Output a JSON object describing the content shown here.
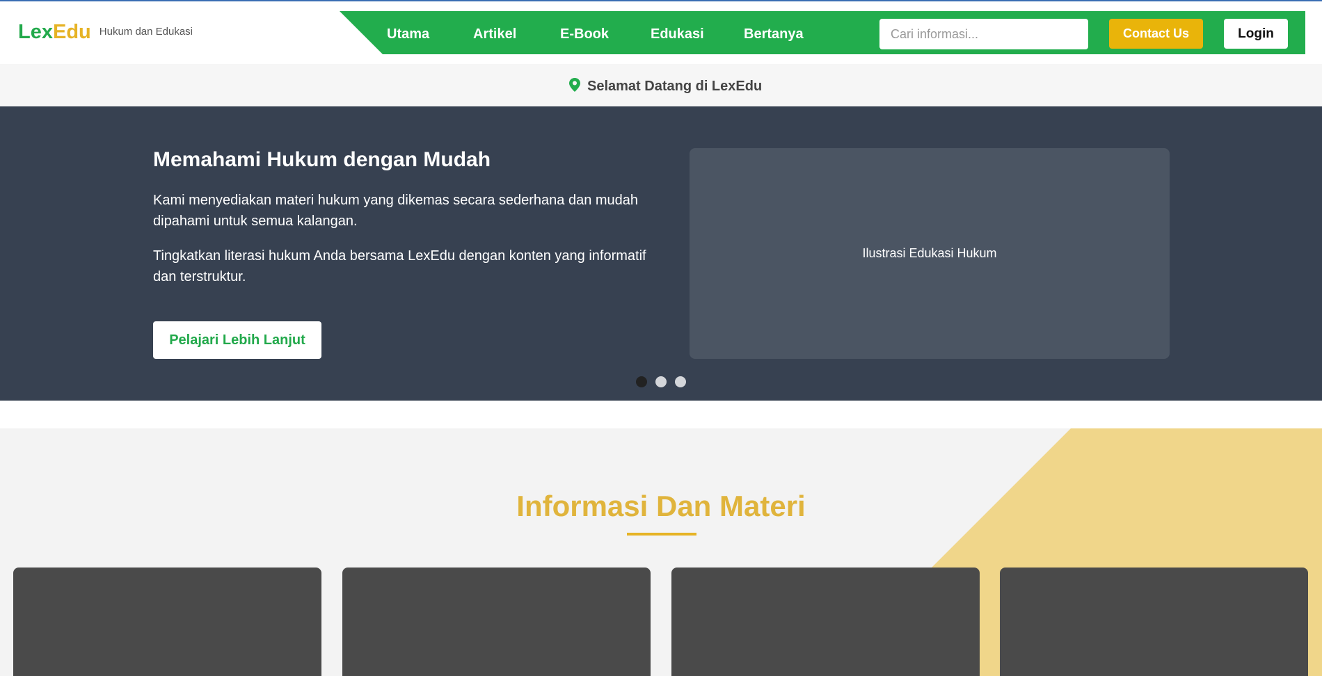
{
  "brand": {
    "name_part1": "Lex",
    "name_part2": "Edu",
    "tagline": "Hukum dan Edukasi"
  },
  "nav": {
    "items": [
      {
        "label": "Utama"
      },
      {
        "label": "Artikel"
      },
      {
        "label": "E-Book"
      },
      {
        "label": "Edukasi"
      },
      {
        "label": "Bertanya"
      }
    ]
  },
  "search": {
    "placeholder": "Cari informasi...",
    "value": ""
  },
  "buttons": {
    "contact": "Contact Us",
    "login": "Login"
  },
  "welcome": {
    "icon": "map-pin-icon",
    "text": "Selamat Datang di LexEdu"
  },
  "hero": {
    "title": "Memahami Hukum dengan Mudah",
    "paragraph1": "Kami menyediakan materi hukum yang dikemas secara sederhana dan mudah dipahami untuk semua kalangan.",
    "paragraph2": "Tingkatkan literasi hukum Anda bersama LexEdu dengan konten yang informatif dan terstruktur.",
    "cta": "Pelajari Lebih Lanjut",
    "illustration_text": "Ilustrasi Edukasi Hukum",
    "slides_count": 3,
    "active_slide": 1
  },
  "info": {
    "title": "Informasi Dan Materi",
    "cards_count": 4
  },
  "colors": {
    "green": "#22ad4d",
    "gold": "#e6b325",
    "hero_bg": "#374151",
    "illustration_bg": "#4b5563",
    "card_bg": "#4a4a4a",
    "deco_yellow": "#f0d68a"
  }
}
